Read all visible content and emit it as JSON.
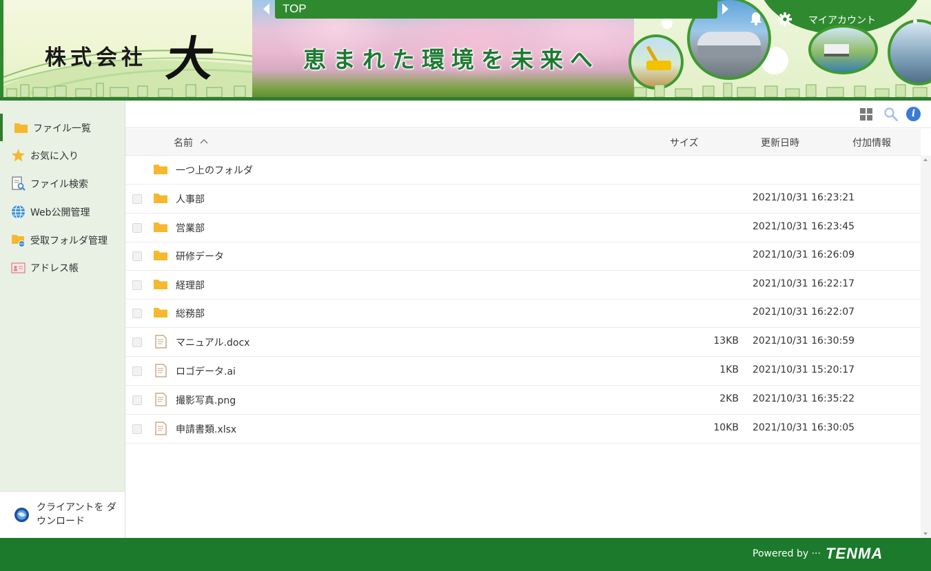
{
  "banner": {
    "logo_text": "株式会社",
    "logo_big": "大",
    "tagline": "恵まれた環境を未来へ",
    "nav_title": "TOP",
    "account_label": "マイアカウント"
  },
  "sidebar": {
    "items": [
      {
        "label": "ファイル一覧",
        "icon": "folder-icon"
      },
      {
        "label": "お気に入り",
        "icon": "star-icon"
      },
      {
        "label": "ファイル検索",
        "icon": "file-search-icon"
      },
      {
        "label": "Web公開管理",
        "icon": "globe-icon"
      },
      {
        "label": "受取フォルダ管理",
        "icon": "receive-folder-icon"
      },
      {
        "label": "アドレス帳",
        "icon": "address-book-icon"
      }
    ],
    "download_label": "クライアントを ダウンロード"
  },
  "table": {
    "columns": {
      "name": "名前",
      "size": "サイズ",
      "date": "更新日時",
      "info": "付加情報"
    },
    "parent_label": "一つ上のフォルダ",
    "rows": [
      {
        "type": "folder",
        "name": "人事部",
        "size": "",
        "date": "2021/10/31 16:23:21"
      },
      {
        "type": "folder",
        "name": "営業部",
        "size": "",
        "date": "2021/10/31 16:23:45"
      },
      {
        "type": "folder",
        "name": "研修データ",
        "size": "",
        "date": "2021/10/31 16:26:09"
      },
      {
        "type": "folder",
        "name": "経理部",
        "size": "",
        "date": "2021/10/31 16:22:17"
      },
      {
        "type": "folder",
        "name": "総務部",
        "size": "",
        "date": "2021/10/31 16:22:07"
      },
      {
        "type": "file",
        "name": "マニュアル.docx",
        "size": "13KB",
        "date": "2021/10/31 16:30:59"
      },
      {
        "type": "file",
        "name": "ロゴデータ.ai",
        "size": "1KB",
        "date": "2021/10/31 15:20:17"
      },
      {
        "type": "file",
        "name": "撮影写真.png",
        "size": "2KB",
        "date": "2021/10/31 16:35:22"
      },
      {
        "type": "file",
        "name": "申請書類.xlsx",
        "size": "10KB",
        "date": "2021/10/31 16:30:05"
      }
    ]
  },
  "footer": {
    "powered": "Powered by ···",
    "brand": "TENMA"
  },
  "colors": {
    "brand_green": "#1b7a2c",
    "sidebar_bg": "#e8f1e4",
    "folder_yellow": "#f5b82e",
    "info_blue": "#3a7bd5"
  }
}
